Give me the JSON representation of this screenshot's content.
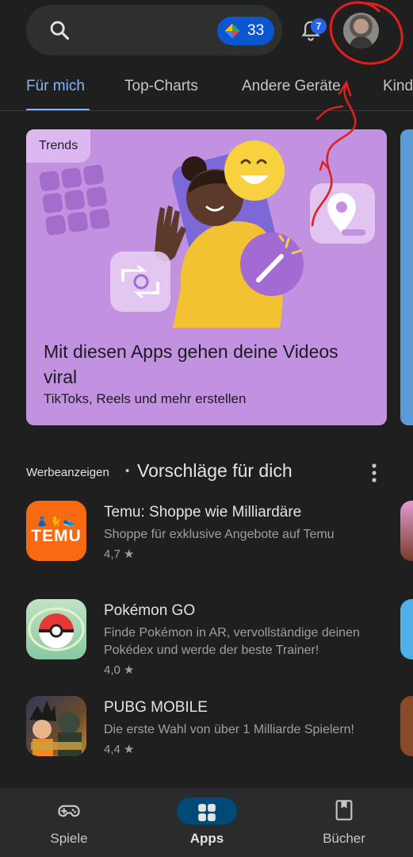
{
  "header": {
    "search_icon": "search-icon",
    "play_points": "33",
    "notification_count": "7",
    "avatar_icon": "profile-avatar"
  },
  "tabs": [
    {
      "label": "Für mich",
      "active": true
    },
    {
      "label": "Top-Charts"
    },
    {
      "label": "Andere Geräte"
    },
    {
      "label": "Kinder"
    }
  ],
  "feature": {
    "tag": "Trends",
    "title": "Mit diesen Apps gehen deine Videos viral",
    "subtitle": "TikToks, Reels und mehr erstellen"
  },
  "section": {
    "ads_label": "Werbeanzeigen",
    "separator": "•",
    "title": "Vorschläge für dich"
  },
  "apps": [
    {
      "name": "Temu: Shoppe wie Milliardäre",
      "description": "Shoppe für exklusive Angebote auf Temu",
      "rating": "4,7 ★",
      "icon_text": "TEMU",
      "icon_glyphs": "👗🐈👟"
    },
    {
      "name": "Pokémon GO",
      "description": "Finde Pokémon in AR, vervollständige deinen Pokédex und werde der beste Trainer!",
      "rating": "4,0 ★"
    },
    {
      "name": "PUBG MOBILE",
      "description": "Die erste Wahl von über 1 Milliarde Spielern!",
      "rating": "4,4 ★"
    }
  ],
  "bottom_nav": [
    {
      "label": "Spiele",
      "icon": "gamepad-icon"
    },
    {
      "label": "Apps",
      "icon": "apps-grid-icon",
      "active": true
    },
    {
      "label": "Bücher",
      "icon": "bookmark-icon"
    }
  ],
  "colors": {
    "background": "#1f1f1f",
    "accent": "#8ab4f8",
    "card": "#c291e0",
    "annotation": "#e0201e"
  }
}
